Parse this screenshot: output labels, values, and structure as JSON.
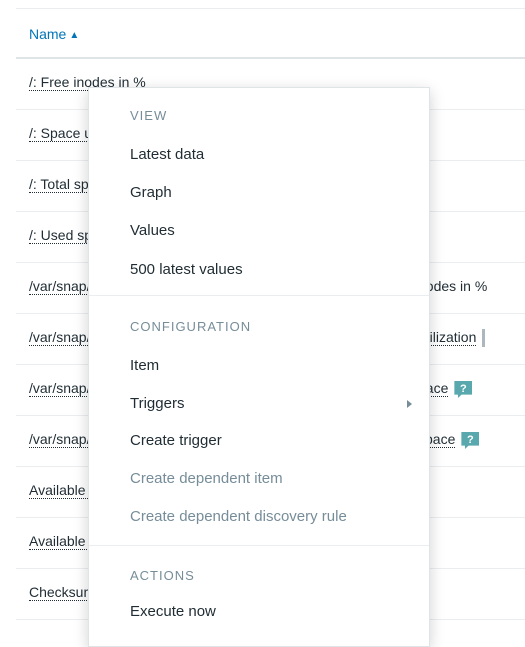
{
  "table": {
    "header": {
      "name_label": "Name",
      "sort_glyph": "▲"
    },
    "rows": [
      {
        "name": "/: Free inodes in %",
        "right": ""
      },
      {
        "name": "/: Space utilization",
        "right": ""
      },
      {
        "name": "/: Total space",
        "right": ""
      },
      {
        "name": "/: Used space",
        "right": ""
      },
      {
        "name": "/var/snap/…: Free inodes in %",
        "right": "nodes in %"
      },
      {
        "name": "/var/snap/…: Space utilization",
        "right": "utilization"
      },
      {
        "name": "/var/snap/…: Total space",
        "right": "pace"
      },
      {
        "name": "/var/snap/…: Used space",
        "right": "space"
      },
      {
        "name": "Available memory",
        "right": ""
      },
      {
        "name": "Available memory in %",
        "right": ""
      },
      {
        "name": "Checksum of /etc/passwd",
        "right": ""
      }
    ],
    "hint_glyph": "?"
  },
  "context_menu": {
    "view": {
      "title": "VIEW",
      "items": [
        "Latest data",
        "Graph",
        "Values",
        "500 latest values"
      ]
    },
    "configuration": {
      "title": "CONFIGURATION",
      "items": [
        "Item",
        "Triggers",
        "Create trigger"
      ],
      "disabled_items": [
        "Create dependent item",
        "Create dependent discovery rule"
      ]
    },
    "actions": {
      "title": "ACTIONS",
      "items": [
        "Execute now"
      ]
    }
  },
  "colors": {
    "link_blue": "#0275b8",
    "muted_gray": "#768d99",
    "hint_teal": "#59a8ae"
  }
}
